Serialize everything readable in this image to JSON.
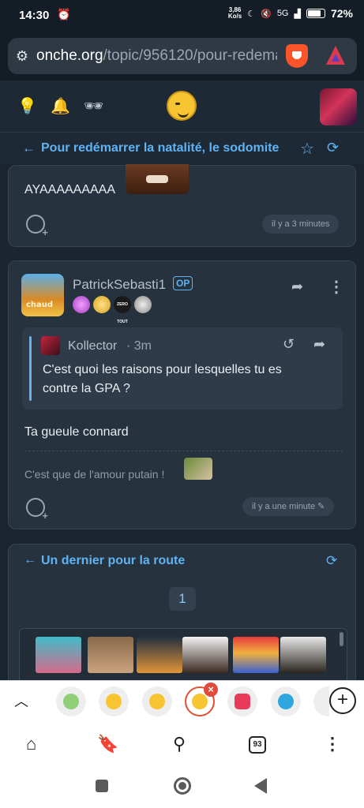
{
  "status_bar": {
    "time": "14:30",
    "alarm_icon": "alarm-icon",
    "net_speed_value": "3,86",
    "net_speed_unit": "Ko/s",
    "signal": "5G",
    "battery_percent": "72%",
    "battery_level": 0.72
  },
  "browser": {
    "url_domain": "onche.org",
    "url_path": "/topic/956120/pour-redema"
  },
  "site_header": {
    "icons": [
      "lightbulb-icon",
      "bell-icon",
      "incognito-icon",
      "smiley-logo",
      "user-avatar"
    ]
  },
  "topic": {
    "title": "Pour redémarrer la natalité, le sodomite"
  },
  "posts": [
    {
      "text": "AYAAAAAAAAA",
      "time": "il y a 3 minutes"
    },
    {
      "author": "PatrickSebasti1",
      "op_badge": "OP",
      "avatar_caption": "chaud",
      "badge_text": "ZERO TOUT",
      "quote": {
        "author": "Kollector",
        "time": "3m",
        "text": "C'est quoi les raisons pour lesquelles tu es contre la GPA ?"
      },
      "body": "Ta gueule connard",
      "signature": "C'est que de l'amour putain !",
      "time": "il y a une minute"
    }
  ],
  "next_section": {
    "title": "Un dernier pour la route",
    "page": "1"
  },
  "nav": {
    "tab_count": "93"
  },
  "colors": {
    "accent": "#5fb3f3",
    "background": "#1b2530",
    "card": "#26323e"
  }
}
